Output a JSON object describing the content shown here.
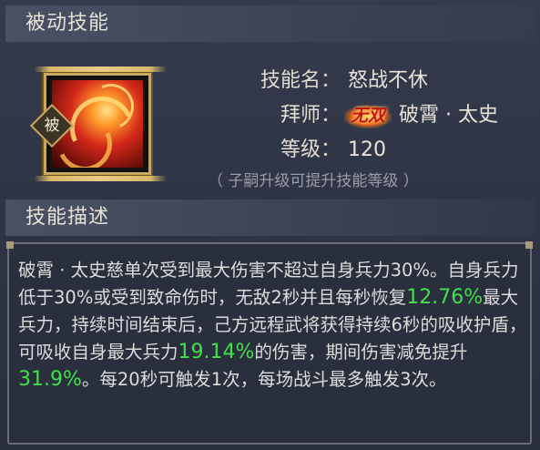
{
  "header_passive": "被动技能",
  "header_desc": "技能描述",
  "badge": "被",
  "skill": {
    "name_label": "技能名：",
    "name": "怒战不休",
    "master_label": "拜师：",
    "master_tag": "无双",
    "master_name": "破霄 · 太史",
    "level_label": "等级：",
    "level": "120",
    "hint": "（ 子嗣升级可提升技能等级 ）"
  },
  "description": {
    "p1": "破霄 · 太史慈单次受到最大伤害不超过自身兵力30%。自身兵力低于30%或受到致命伤时，无敌2秒并且每秒恢复",
    "v1": "12.76%",
    "p2": "最大兵力，持续时间结束后，己方远程武将获得持续6秒的吸收护盾，可吸收自身最大兵力",
    "v2": "19.14%",
    "p3": "的伤害，期间伤害减免提升",
    "v3": "31.9%",
    "p4": "。每20秒可触发1次，每场战斗最多触发3次。"
  },
  "colors": {
    "highlight": "#3fe04a",
    "text": "#dcdcdc",
    "frame_gold": "#c9a85c"
  }
}
